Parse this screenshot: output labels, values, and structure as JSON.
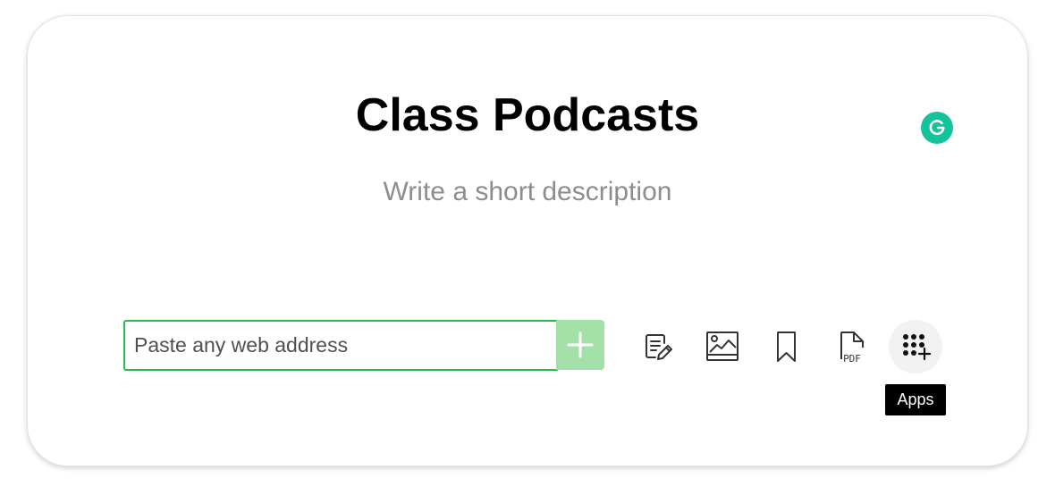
{
  "page": {
    "title": "Class Podcasts",
    "description_placeholder": "Write a short description"
  },
  "link_bar": {
    "url_placeholder": "Paste any web address",
    "url_value": "",
    "add_icon": "plus-icon"
  },
  "toolbar": {
    "items": [
      {
        "name": "text-post",
        "icon": "note-pencil-icon"
      },
      {
        "name": "image-upload",
        "icon": "image-icon"
      },
      {
        "name": "bookmark",
        "icon": "bookmark-icon"
      },
      {
        "name": "pdf-upload",
        "icon": "pdf-file-icon"
      },
      {
        "name": "apps",
        "icon": "apps-grid-plus-icon"
      }
    ],
    "tooltip": "Apps"
  },
  "extensions": {
    "grammarly_icon": "grammarly-icon"
  },
  "colors": {
    "accent_green": "#2db84d",
    "add_button_green": "#a3e0a8",
    "grammarly_green": "#15c39a"
  }
}
